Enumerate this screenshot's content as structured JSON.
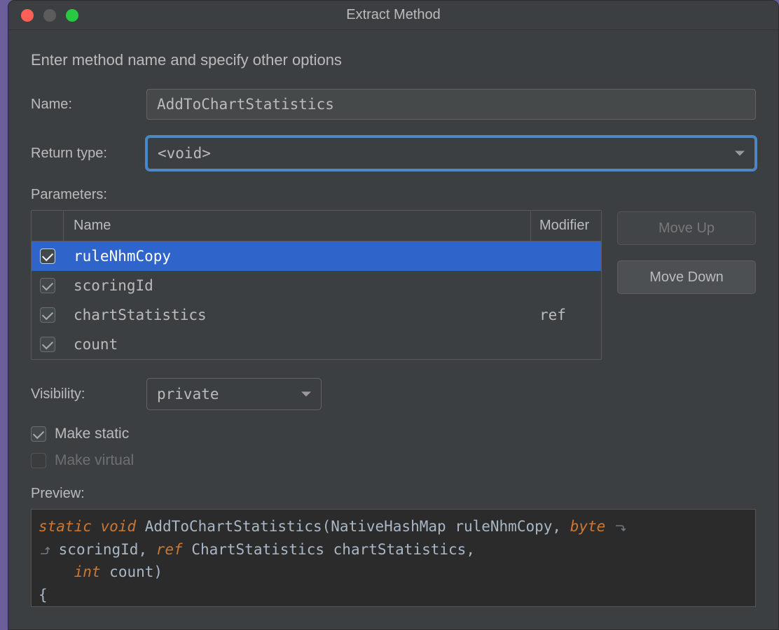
{
  "window": {
    "title": "Extract Method"
  },
  "instructions": "Enter method name and specify other options",
  "labels": {
    "name": "Name:",
    "return_type": "Return type:",
    "parameters": "Parameters:",
    "visibility": "Visibility:",
    "preview": "Preview:"
  },
  "fields": {
    "name_value": "AddToChartStatistics",
    "return_type_value": "<void>",
    "visibility_value": "private"
  },
  "table": {
    "col_name": "Name",
    "col_modifier": "Modifier",
    "rows": [
      {
        "checked": true,
        "name": "ruleNhmCopy",
        "modifier": "",
        "selected": true
      },
      {
        "checked": true,
        "name": "scoringId",
        "modifier": "",
        "selected": false
      },
      {
        "checked": true,
        "name": "chartStatistics",
        "modifier": "ref",
        "selected": false
      },
      {
        "checked": true,
        "name": "count",
        "modifier": "",
        "selected": false
      }
    ]
  },
  "buttons": {
    "move_up": "Move Up",
    "move_down": "Move Down"
  },
  "options": {
    "make_static": {
      "label": "Make static",
      "checked": true,
      "enabled": true
    },
    "make_virtual": {
      "label": "Make virtual",
      "checked": false,
      "enabled": false
    }
  },
  "preview": {
    "kw_static": "static",
    "kw_void": "void",
    "method_name": "AddToChartStatistics",
    "p1_type": "NativeHashMap",
    "p1_name": "ruleNhmCopy",
    "kw_byte": "byte",
    "p2_name": "scoringId",
    "kw_ref": "ref",
    "p3_type": "ChartStatistics",
    "p3_name": "chartStatistics",
    "kw_int": "int",
    "p4_name": "count",
    "brace": "{"
  }
}
